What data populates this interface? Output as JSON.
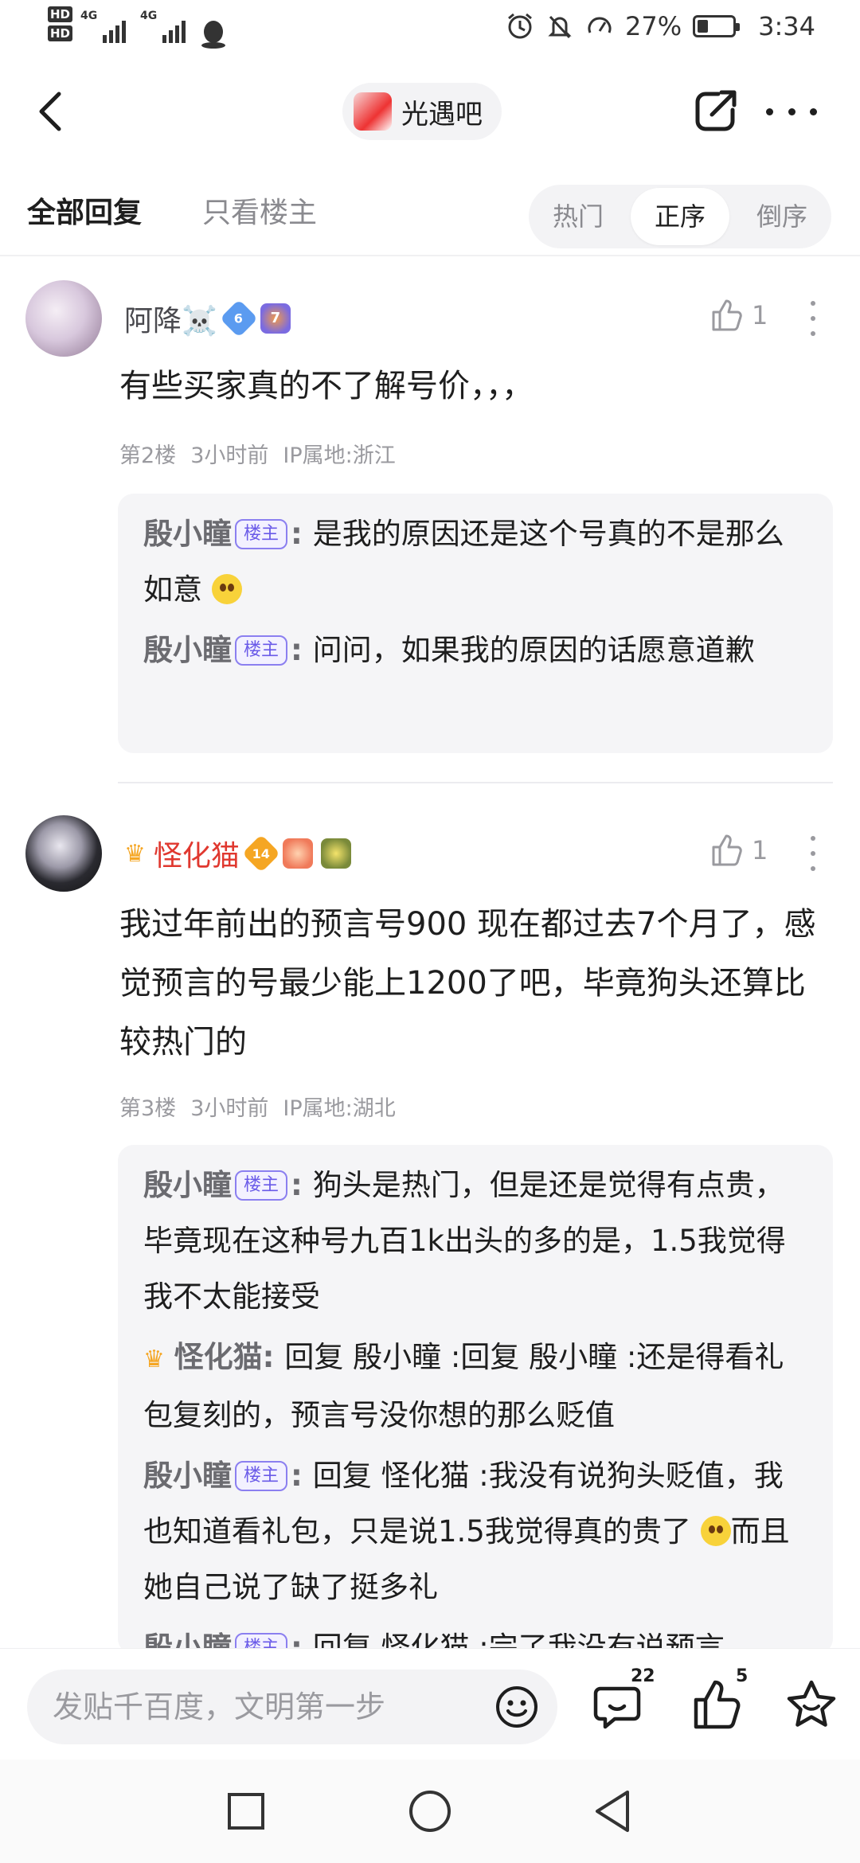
{
  "status_bar": {
    "hd1": "HD",
    "hd2": "HD",
    "net1": "4G",
    "net2": "4G",
    "battery_percent": "27%",
    "battery_level": 0.27,
    "time": "3:34"
  },
  "nav": {
    "forum_name": "光遇吧"
  },
  "filter": {
    "all_replies": "全部回复",
    "only_op": "只看楼主",
    "sort_options": [
      "热门",
      "正序",
      "倒序"
    ],
    "sort_selected": "正序"
  },
  "posts": [
    {
      "username": "阿降☠️",
      "level": "6",
      "badge2_level": "7",
      "likes": "1",
      "content": "有些买家真的不了解号价，，，",
      "floor": "第2楼",
      "time": "3小时前",
      "ip": "IP属地:浙江",
      "replies": [
        {
          "name": "殷小瞳",
          "tag": "楼主",
          "text": "是我的原因还是这个号真的不是那么如意"
        },
        {
          "name": "殷小瞳",
          "tag": "楼主",
          "text": "问问，如果我的原因的话愿意道歉"
        }
      ]
    },
    {
      "username": "怪化猫",
      "level": "14",
      "likes": "1",
      "content": "我过年前出的预言号900 现在都过去7个月了，感觉预言的号最少能上1200了吧，毕竟狗头还算比较热门的",
      "floor": "第3楼",
      "time": "3小时前",
      "ip": "IP属地:湖北",
      "replies": [
        {
          "name": "殷小瞳",
          "tag": "楼主",
          "text": "狗头是热门，但是还是觉得有点贵，毕竟现在这种号九百1k出头的多的是，1.5我觉得我不太能接受"
        },
        {
          "name": "怪化猫",
          "tag": "",
          "text": "回复 殷小瞳 :回复 殷小瞳 :还是得看礼包复刻的，预言号没你想的那么贬值"
        },
        {
          "name": "殷小瞳",
          "tag": "楼主",
          "text_a": "回复 怪化猫 :我没有说狗头贬值，我也知道看礼包，只是说1.5我觉得真的贵了",
          "text_b": "而且她自己说了缺了挺多礼"
        },
        {
          "name": "殷小瞳",
          "tag": "楼主",
          "text": "回复 怪化猫 :完了我没有说预言"
        }
      ]
    }
  ],
  "bottom": {
    "input_placeholder": "发贴千百度，文明第一步",
    "comment_count": "22",
    "like_count": "5"
  },
  "colors": {
    "accent_purple": "#6a5ae8",
    "username_red": "#e0382f",
    "muted": "#9a9a9f"
  }
}
